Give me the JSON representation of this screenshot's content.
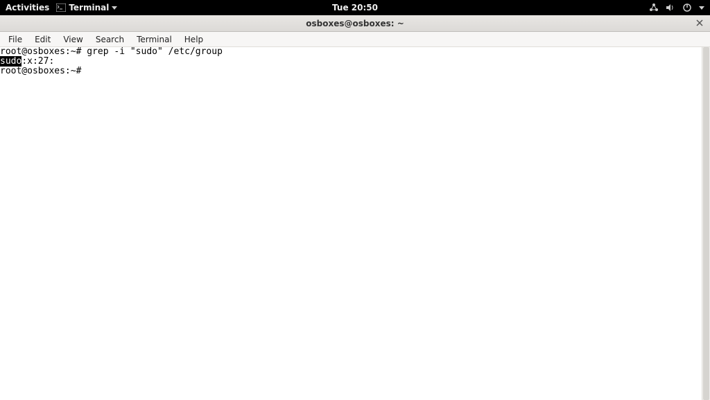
{
  "topbar": {
    "activities": "Activities",
    "app_label": "Terminal",
    "clock": "Tue 20:50"
  },
  "window": {
    "title": "osboxes@osboxes: ~"
  },
  "menubar": {
    "file": "File",
    "edit": "Edit",
    "view": "View",
    "search": "Search",
    "terminal": "Terminal",
    "help": "Help"
  },
  "terminal": {
    "line1_prompt": "root@osboxes:~# ",
    "line1_cmd": "grep -i \"sudo\" /etc/group",
    "line2_match": "sudo",
    "line2_rest": ":x:27:",
    "line3_prompt": "root@osboxes:~# "
  }
}
